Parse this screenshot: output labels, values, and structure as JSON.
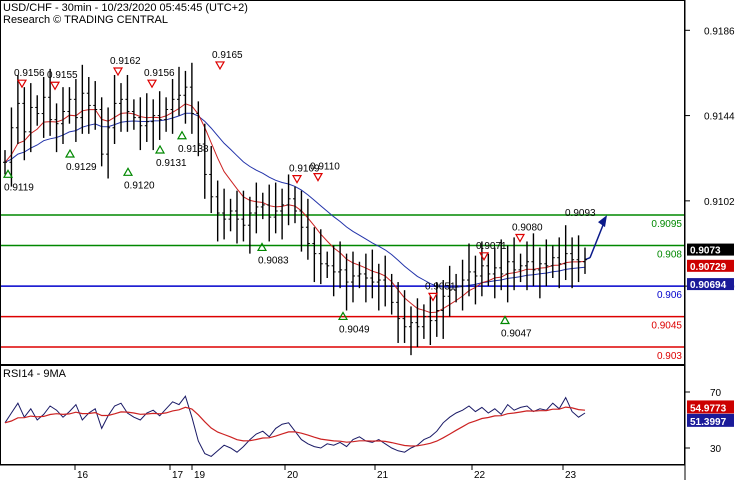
{
  "header": {
    "title": "USD/CHF - 30min - 10/23/2020 05:45:45 (UTC+2)",
    "subtitle": "Research © TRADING CENTRAL"
  },
  "colors": {
    "support": "#dd0000",
    "resistance": "#008800",
    "pivot": "#0000cc",
    "price": "#000000",
    "ma_red": "#cc2222",
    "ma_blue": "#2233aa",
    "arrow": "#0a1a8a"
  },
  "chart_data": [
    {
      "type": "line",
      "name": "price-panel",
      "ylim": [
        0.9031,
        0.9196
      ],
      "y_ticks": [
        "0.9186",
        "0.9144",
        "0.9102",
        "0.9060"
      ],
      "x_tick_labels": [
        "16",
        "17",
        "19",
        "20",
        "21",
        "22",
        "23"
      ],
      "levels": [
        {
          "value": 0.9095,
          "label": "0.9095",
          "kind": "resistance"
        },
        {
          "value": 0.908,
          "label": "0.908",
          "kind": "resistance"
        },
        {
          "value": 0.906,
          "label": "0.906",
          "kind": "pivot"
        },
        {
          "value": 0.9045,
          "label": "0.9045",
          "kind": "support"
        },
        {
          "value": 0.903,
          "label": "0.903",
          "kind": "support"
        }
      ],
      "last_price": {
        "value": 0.9073,
        "label": "0.9073"
      },
      "ma_red_last": {
        "value": 0.9073,
        "label": "0.90729"
      },
      "ma_blue_last": {
        "value": 0.9069,
        "label": "0.90694"
      },
      "forecast_target": {
        "value": 0.9093,
        "label": "0.9093"
      },
      "swing_points": [
        {
          "label": "0.9119",
          "kind": "low",
          "value": 0.9119
        },
        {
          "label": "0.9156",
          "kind": "high",
          "value": 0.9156
        },
        {
          "label": "0.9155",
          "kind": "high",
          "value": 0.9155
        },
        {
          "label": "0.9129",
          "kind": "low",
          "value": 0.9129
        },
        {
          "label": "0.9162",
          "kind": "high",
          "value": 0.9162
        },
        {
          "label": "0.9120",
          "kind": "low",
          "value": 0.912
        },
        {
          "label": "0.9156",
          "kind": "high",
          "value": 0.9156
        },
        {
          "label": "0.9131",
          "kind": "low",
          "value": 0.9131
        },
        {
          "label": "0.9138",
          "kind": "low",
          "value": 0.9138
        },
        {
          "label": "0.9165",
          "kind": "high",
          "value": 0.9165
        },
        {
          "label": "0.9109",
          "kind": "high",
          "value": 0.9109
        },
        {
          "label": "0.9110",
          "kind": "high",
          "value": 0.911
        },
        {
          "label": "0.9083",
          "kind": "low",
          "value": 0.9083
        },
        {
          "label": "0.9049",
          "kind": "low",
          "value": 0.9049
        },
        {
          "label": "0.9051",
          "kind": "high",
          "value": 0.9051
        },
        {
          "label": "0.9071",
          "kind": "high",
          "value": 0.9071
        },
        {
          "label": "0.9080",
          "kind": "high",
          "value": 0.908
        },
        {
          "label": "0.9047",
          "kind": "low",
          "value": 0.9047
        }
      ],
      "price_path": [
        0.9121,
        0.9138,
        0.915,
        0.9136,
        0.9148,
        0.9145,
        0.9153,
        0.9142,
        0.914,
        0.9146,
        0.9152,
        0.9143,
        0.9155,
        0.9149,
        0.9147,
        0.9125,
        0.9138,
        0.915,
        0.9152,
        0.9146,
        0.9143,
        0.9139,
        0.9141,
        0.9144,
        0.9142,
        0.9147,
        0.9152,
        0.9154,
        0.9158,
        0.9145,
        0.913,
        0.9115,
        0.9104,
        0.9096,
        0.9093,
        0.9097,
        0.9093,
        0.909,
        0.9096,
        0.9099,
        0.91,
        0.9094,
        0.9097,
        0.91,
        0.9103,
        0.9097,
        0.9089,
        0.9081,
        0.9076,
        0.9071,
        0.907,
        0.9067,
        0.9068,
        0.9062,
        0.9065,
        0.9066,
        0.9064,
        0.9062,
        0.9063,
        0.906,
        0.9052,
        0.9044,
        0.904,
        0.9042,
        0.904,
        0.9045,
        0.9043,
        0.9048,
        0.9055,
        0.9058,
        0.906,
        0.9063,
        0.9067,
        0.9065,
        0.907,
        0.9066,
        0.9069,
        0.9066,
        0.9072,
        0.9068,
        0.907,
        0.9072,
        0.9068,
        0.9071,
        0.907,
        0.9074,
        0.9071,
        0.9076,
        0.9073,
        0.9072,
        0.9073
      ]
    },
    {
      "type": "line",
      "name": "rsi-panel",
      "title": "RSI14 - 9MA",
      "ylim": [
        20,
        80
      ],
      "y_ticks": [
        "70",
        "30"
      ],
      "rsi_last": {
        "value": 54.9773,
        "label": "54.9773"
      },
      "ma_last": {
        "value": 51.3997,
        "label": "51.3997"
      },
      "rsi_path": [
        48,
        55,
        62,
        52,
        58,
        50,
        54,
        60,
        57,
        52,
        56,
        61,
        50,
        55,
        58,
        44,
        53,
        60,
        62,
        55,
        52,
        50,
        55,
        57,
        53,
        58,
        63,
        61,
        67,
        52,
        35,
        26,
        24,
        28,
        32,
        30,
        27,
        31,
        36,
        40,
        42,
        38,
        44,
        47,
        48,
        42,
        36,
        33,
        31,
        30,
        33,
        32,
        34,
        31,
        36,
        38,
        35,
        34,
        36,
        33,
        30,
        28,
        27,
        30,
        32,
        36,
        38,
        42,
        48,
        52,
        55,
        57,
        60,
        56,
        59,
        55,
        58,
        54,
        61,
        57,
        59,
        60,
        56,
        58,
        57,
        62,
        58,
        66,
        56,
        52,
        55
      ]
    }
  ]
}
